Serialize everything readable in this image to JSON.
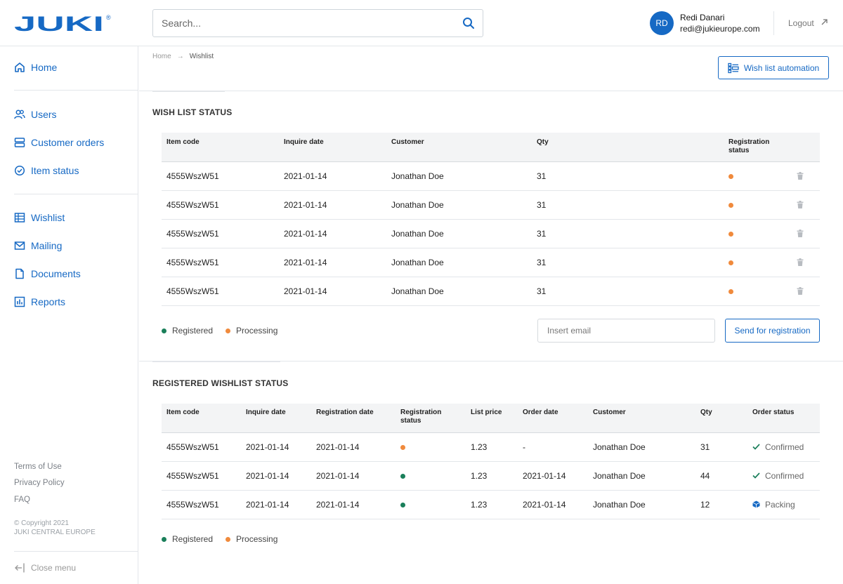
{
  "header": {
    "logo_text": "JUKI",
    "search_placeholder": "Search...",
    "user_initials": "RD",
    "user_name": "Redi Danari",
    "user_email": "redi@jukieurope.com",
    "logout_label": "Logout"
  },
  "sidebar": {
    "items": [
      {
        "label": "Home",
        "icon": "home-icon"
      },
      {
        "label": "Users",
        "icon": "users-icon"
      },
      {
        "label": "Customer orders",
        "icon": "orders-icon"
      },
      {
        "label": "Item status",
        "icon": "check-circle-icon"
      },
      {
        "label": "Wishlist",
        "icon": "table-icon"
      },
      {
        "label": "Mailing",
        "icon": "mail-icon"
      },
      {
        "label": "Documents",
        "icon": "document-icon"
      },
      {
        "label": "Reports",
        "icon": "chart-icon"
      }
    ],
    "footer_links": [
      "Terms of Use",
      "Privacy Policy",
      "FAQ"
    ],
    "copyright_line1": "© Copyright 2021",
    "copyright_line2": "JUKI CENTRAL EUROPE",
    "close_menu_label": "Close menu"
  },
  "breadcrumb": {
    "home": "Home",
    "current": "Wishlist"
  },
  "wishlist_automation_label": "Wish list automation",
  "colors": {
    "accent": "#1669c4",
    "registered": "#1a7f5a",
    "processing": "#f08a3c"
  },
  "wishlist_status": {
    "title": "WISH LIST STATUS",
    "columns": [
      "Item code",
      "Inquire date",
      "Customer",
      "Qty",
      "Registration status"
    ],
    "rows": [
      {
        "item_code": "4555WszW51",
        "inquire_date": "2021-01-14",
        "customer": "Jonathan Doe",
        "qty": "31",
        "status": "processing"
      },
      {
        "item_code": "4555WszW51",
        "inquire_date": "2021-01-14",
        "customer": "Jonathan Doe",
        "qty": "31",
        "status": "processing"
      },
      {
        "item_code": "4555WszW51",
        "inquire_date": "2021-01-14",
        "customer": "Jonathan Doe",
        "qty": "31",
        "status": "processing"
      },
      {
        "item_code": "4555WszW51",
        "inquire_date": "2021-01-14",
        "customer": "Jonathan Doe",
        "qty": "31",
        "status": "processing"
      },
      {
        "item_code": "4555WszW51",
        "inquire_date": "2021-01-14",
        "customer": "Jonathan Doe",
        "qty": "31",
        "status": "processing"
      }
    ],
    "legend": {
      "registered": "Registered",
      "processing": "Processing"
    },
    "email_placeholder": "Insert email",
    "send_label": "Send for registration"
  },
  "registered_status": {
    "title": "REGISTERED WISHLIST STATUS",
    "columns": [
      "Item code",
      "Inquire date",
      "Registration date",
      "Registration status",
      "List price",
      "Order date",
      "Customer",
      "Qty",
      "Order status"
    ],
    "rows": [
      {
        "item_code": "4555WszW51",
        "inquire_date": "2021-01-14",
        "registration_date": "2021-01-14",
        "status": "processing",
        "list_price": "1.23",
        "order_date": "-",
        "customer": "Jonathan Doe",
        "qty": "31",
        "order_status": "Confirmed",
        "order_icon": "check-icon"
      },
      {
        "item_code": "4555WszW51",
        "inquire_date": "2021-01-14",
        "registration_date": "2021-01-14",
        "status": "registered",
        "list_price": "1.23",
        "order_date": "2021-01-14",
        "customer": "Jonathan Doe",
        "qty": "44",
        "order_status": "Confirmed",
        "order_icon": "check-icon"
      },
      {
        "item_code": "4555WszW51",
        "inquire_date": "2021-01-14",
        "registration_date": "2021-01-14",
        "status": "registered",
        "list_price": "1.23",
        "order_date": "2021-01-14",
        "customer": "Jonathan Doe",
        "qty": "12",
        "order_status": "Packing",
        "order_icon": "box-icon"
      }
    ],
    "legend": {
      "registered": "Registered",
      "processing": "Processing"
    }
  }
}
